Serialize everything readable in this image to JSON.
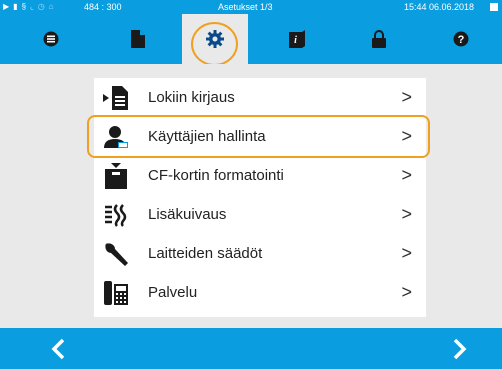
{
  "status_bar": {
    "coords": "484 : 300",
    "title": "Asetukset 1/3",
    "datetime": "15:44  06.06.2018",
    "icons": [
      "play-icon",
      "document-icon",
      "steam-icon",
      "chart-icon",
      "clock-icon",
      "lock-icon"
    ]
  },
  "nav_tabs": [
    {
      "icon": "list-icon",
      "active": false
    },
    {
      "icon": "document-icon",
      "active": false
    },
    {
      "icon": "gear-icon",
      "active": true
    },
    {
      "icon": "info-book-icon",
      "active": false
    },
    {
      "icon": "lock-icon",
      "active": false
    },
    {
      "icon": "help-icon",
      "active": false
    }
  ],
  "menu_items": [
    {
      "label": "Lokiin kirjaus",
      "icon": "log-output-icon"
    },
    {
      "label": "Käyttäjien hallinta",
      "icon": "user-management-icon",
      "highlighted": true
    },
    {
      "label": "CF-kortin formatointi",
      "icon": "cf-card-format-icon"
    },
    {
      "label": "Lisäkuivaus",
      "icon": "drying-icon"
    },
    {
      "label": "Laitteiden säädöt",
      "icon": "wrench-icon"
    },
    {
      "label": "Palvelu",
      "icon": "service-phone-icon"
    }
  ],
  "chevron": ">",
  "footer": {
    "prev": "<",
    "next": ">"
  },
  "colors": {
    "accent": "#0a9ee0",
    "highlight": "#f0a020",
    "background": "#e9e9e9"
  }
}
